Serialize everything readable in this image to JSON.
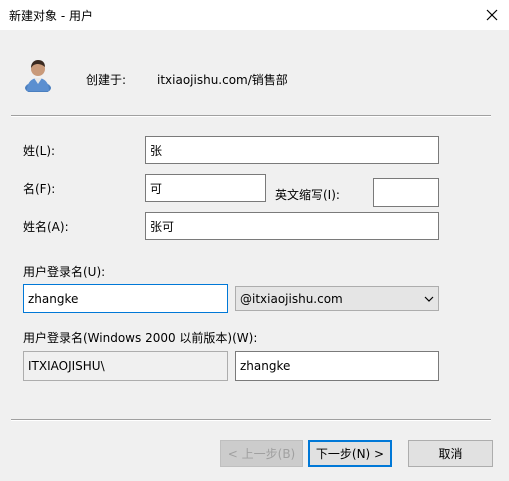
{
  "window": {
    "title": "新建对象 - 用户"
  },
  "header": {
    "created_in_label": "创建于:",
    "created_in_path": "itxiaojishu.com/销售部"
  },
  "form": {
    "last_name_label": "姓(L):",
    "last_name_value": "张",
    "first_name_label": "名(F):",
    "first_name_value": "可",
    "initials_label": "英文缩写(I):",
    "initials_value": "",
    "full_name_label": "姓名(A):",
    "full_name_value": "张可",
    "logon_name_label": "用户登录名(U):",
    "logon_name_value": "zhangke",
    "domain_selected": "@itxiaojishu.com",
    "pre2000_label": "用户登录名(Windows 2000 以前版本)(W):",
    "pre2000_domain": "ITXIAOJISHU\\",
    "pre2000_name": "zhangke"
  },
  "buttons": {
    "back": "< 上一步(B)",
    "next": "下一步(N) >",
    "cancel": "取消"
  }
}
